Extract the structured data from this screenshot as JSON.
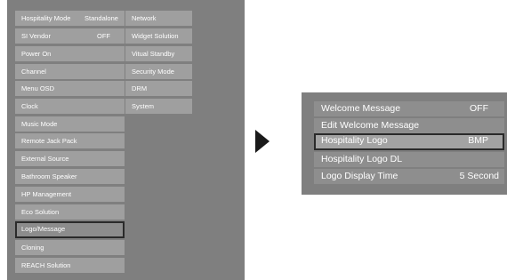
{
  "left_menu": {
    "col1": [
      {
        "label": "Hospitality Mode",
        "value": "Standalone"
      },
      {
        "label": "SI Vendor",
        "value": "OFF"
      },
      {
        "label": "Power On"
      },
      {
        "label": "Channel"
      },
      {
        "label": "Menu OSD"
      },
      {
        "label": "Clock"
      },
      {
        "label": "Music Mode"
      },
      {
        "label": "Remote Jack Pack"
      },
      {
        "label": "External Source"
      },
      {
        "label": "Bathroom Speaker"
      },
      {
        "label": "HP Management"
      },
      {
        "label": "Eco Solution"
      },
      {
        "label": "Logo/Message",
        "selected": true
      },
      {
        "label": "Cloning"
      },
      {
        "label": "REACH Solution"
      }
    ],
    "col2": [
      {
        "label": "Network"
      },
      {
        "label": "Widget Solution"
      },
      {
        "label": "Vitual Standby"
      },
      {
        "label": "Security Mode"
      },
      {
        "label": "DRM"
      },
      {
        "label": "System"
      }
    ]
  },
  "submenu": {
    "items": [
      {
        "label": "Welcome Message",
        "value": "OFF"
      },
      {
        "label": "Edit Welcome Message"
      },
      {
        "label": "Hospitality Logo",
        "value": "BMP",
        "selected": true
      },
      {
        "label": "Hospitality Logo DL"
      },
      {
        "label": "Logo Display Time",
        "value": "5 Second"
      }
    ]
  },
  "icons": {
    "arrow": "right-triangle-arrow"
  },
  "colors": {
    "panel": "#7f7f7f",
    "cell": "#9f9f9f",
    "selection_border": "#2a2a2a",
    "text": "#ffffff"
  }
}
